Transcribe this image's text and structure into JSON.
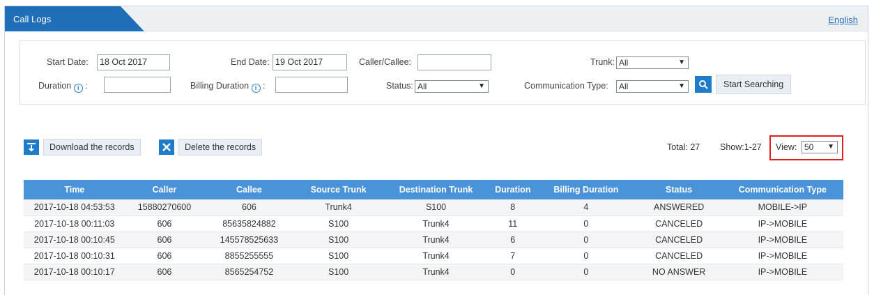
{
  "header": {
    "tab_title": "Call Logs",
    "language_link": "English"
  },
  "search": {
    "start_date_label": "Start Date:",
    "start_date_value": "18 Oct 2017",
    "end_date_label": "End Date:",
    "end_date_value": "19 Oct 2017",
    "caller_callee_label": "Caller/Callee:",
    "caller_callee_value": "",
    "trunk_label": "Trunk:",
    "trunk_value": "All",
    "duration_label": "Duration",
    "duration_value": "",
    "billing_duration_label": "Billing Duration",
    "billing_duration_value": "",
    "status_label": "Status:",
    "status_value": "All",
    "comm_type_label": "Communication Type:",
    "comm_type_value": "All",
    "search_button": "Start Searching"
  },
  "actions": {
    "download_label": "Download the records",
    "delete_label": "Delete the records"
  },
  "summary": {
    "total": "Total: 27",
    "show": "Show:1-27",
    "view_label": "View:",
    "view_value": "50"
  },
  "table": {
    "columns": [
      "Time",
      "Caller",
      "Callee",
      "Source Trunk",
      "Destination Trunk",
      "Duration",
      "Billing Duration",
      "Status",
      "Communication Type"
    ],
    "rows": [
      [
        "2017-10-18 04:53:53",
        "15880270600",
        "606",
        "Trunk4",
        "S100",
        "8",
        "4",
        "ANSWERED",
        "MOBILE->IP"
      ],
      [
        "2017-10-18 00:11:03",
        "606",
        "85635824882",
        "S100",
        "Trunk4",
        "11",
        "0",
        "CANCELED",
        "IP->MOBILE"
      ],
      [
        "2017-10-18 00:10:45",
        "606",
        "145578525633",
        "S100",
        "Trunk4",
        "6",
        "0",
        "CANCELED",
        "IP->MOBILE"
      ],
      [
        "2017-10-18 00:10:31",
        "606",
        "8855255555",
        "S100",
        "Trunk4",
        "7",
        "0",
        "CANCELED",
        "IP->MOBILE"
      ],
      [
        "2017-10-18 00:10:17",
        "606",
        "8565254752",
        "S100",
        "Trunk4",
        "0",
        "0",
        "NO ANSWER",
        "IP->MOBILE"
      ]
    ]
  },
  "colors": {
    "accent": "#1f7cc8",
    "table_header": "#4a93d8",
    "highlight": "#e02020"
  }
}
